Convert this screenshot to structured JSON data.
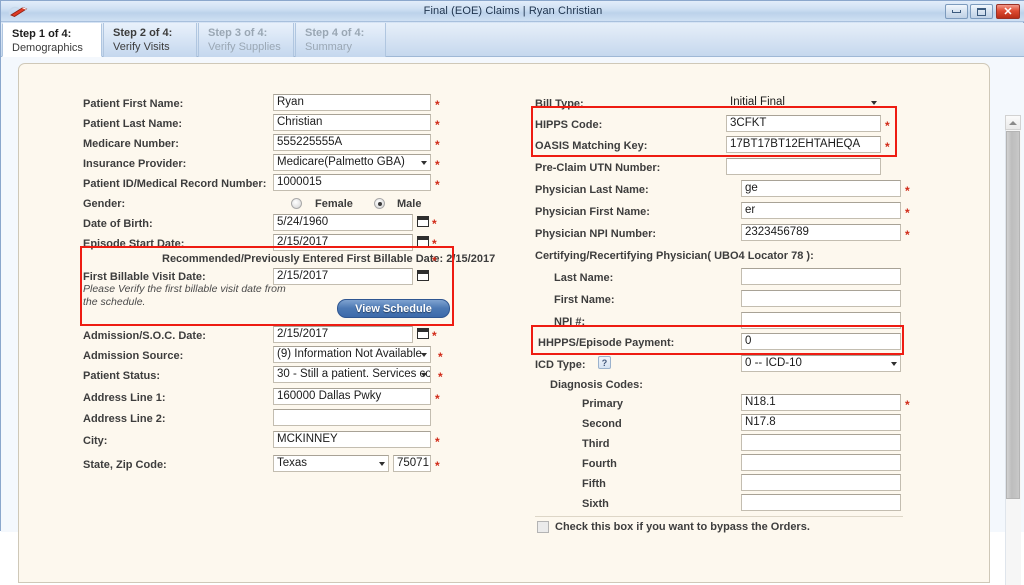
{
  "window": {
    "title": "Final (EOE) Claims | Ryan Christian",
    "app_icon": "claims-app-icon",
    "minimize_icon": "minimize-icon",
    "maximize_icon": "maximize-icon",
    "close_icon": "close-icon",
    "close_glyph": "✕"
  },
  "tabs": [
    {
      "step": "Step 1 of 4:",
      "label": "Demographics",
      "state": "active"
    },
    {
      "step": "Step 2 of 4:",
      "label": "Verify Visits",
      "state": "enabled"
    },
    {
      "step": "Step 3 of 4:",
      "label": "Verify Supplies",
      "state": "disabled"
    },
    {
      "step": "Step 4 of 4:",
      "label": "Summary",
      "state": "disabled"
    }
  ],
  "left": {
    "patient_first_name": {
      "label": "Patient First Name:",
      "value": "Ryan",
      "required": true
    },
    "patient_last_name": {
      "label": "Patient Last Name:",
      "value": "Christian",
      "required": true
    },
    "medicare_number": {
      "label": "Medicare Number:",
      "value": "555225555A",
      "required": true
    },
    "insurance_provider": {
      "label": "Insurance Provider:",
      "value": "Medicare(Palmetto GBA)",
      "required": true
    },
    "patient_id": {
      "label": "Patient ID/Medical Record Number:",
      "value": "1000015",
      "required": true
    },
    "gender": {
      "label": "Gender:",
      "female_label": "Female",
      "male_label": "Male",
      "selected": "Male"
    },
    "date_of_birth": {
      "label": "Date of Birth:",
      "value": "5/24/1960",
      "required": true
    },
    "episode_start_date": {
      "label": "Episode Start Date:",
      "value": "2/15/2017",
      "required": true
    },
    "recommended_note": "Recommended/Previously Entered First Billable Date: 2/15/2017",
    "first_billable_visit_date": {
      "label": "First Billable Visit Date:",
      "value": "2/15/2017",
      "required": true
    },
    "verify_hint": "Please Verify the first billable visit date from the schedule.",
    "view_schedule_label": "View Schedule",
    "admission_soc_date": {
      "label": "Admission/S.O.C. Date:",
      "value": "2/15/2017",
      "required": true
    },
    "admission_source": {
      "label": "Admission Source:",
      "value": "(9) Information Not Available",
      "required": true
    },
    "patient_status": {
      "label": "Patient Status:",
      "value": "30 - Still a patient. Services co",
      "required": true
    },
    "address_line_1": {
      "label": "Address Line 1:",
      "value": "160000 Dallas Pwky",
      "required": true
    },
    "address_line_2": {
      "label": "Address Line 2:",
      "value": "",
      "required": false
    },
    "city": {
      "label": "City:",
      "value": "MCKINNEY",
      "required": true
    },
    "state_zip": {
      "label": "State, Zip Code:",
      "state_value": "Texas",
      "zip_value": "75071",
      "required": true
    }
  },
  "right": {
    "bill_type": {
      "label": "Bill Type:",
      "value": "Initial Final"
    },
    "hipps_code": {
      "label": "HIPPS Code:",
      "value": "3CFKT",
      "required": true
    },
    "oasis_matching_key": {
      "label": "OASIS Matching Key:",
      "value": "17BT17BT12EHTAHEQA",
      "required": true
    },
    "pre_claim_utn": {
      "label": "Pre-Claim UTN Number:",
      "value": "",
      "required": false
    },
    "physician_last_name": {
      "label": "Physician Last Name:",
      "value": "ge",
      "required": true
    },
    "physician_first_name": {
      "label": "Physician First Name:",
      "value": "er",
      "required": true
    },
    "physician_npi": {
      "label": "Physician NPI Number:",
      "value": "2323456789",
      "required": true
    },
    "certifying_header": "Certifying/Recertifying Physician( UBO4 Locator 78 ):",
    "cert_last_name": {
      "label": "Last Name:",
      "value": ""
    },
    "cert_first_name": {
      "label": "First Name:",
      "value": ""
    },
    "cert_npi": {
      "label": "NPI #:",
      "value": ""
    },
    "hhpps_episode_payment": {
      "label": "HHPPS/Episode Payment:",
      "value": "0"
    },
    "icd_type": {
      "label": "ICD Type:",
      "value": "0 -- ICD-10",
      "help_icon": "help-question-icon",
      "help_glyph": "?"
    },
    "diagnosis_header": "Diagnosis Codes:",
    "diagnosis": [
      {
        "label": "Primary",
        "value": "N18.1",
        "required": true
      },
      {
        "label": "Second",
        "value": "N17.8",
        "required": false
      },
      {
        "label": "Third",
        "value": "",
        "required": false
      },
      {
        "label": "Fourth",
        "value": "",
        "required": false
      },
      {
        "label": "Fifth",
        "value": "",
        "required": false
      },
      {
        "label": "Sixth",
        "value": "",
        "required": false
      }
    ],
    "bypass_orders": {
      "label": "Check this box if you want to bypass the Orders.",
      "checked": false
    }
  },
  "colors": {
    "highlight": "#ee1c12",
    "panel_bg": "#fdf8ee",
    "required_star": "#d12b19",
    "button_blue": "#4d79b4"
  }
}
